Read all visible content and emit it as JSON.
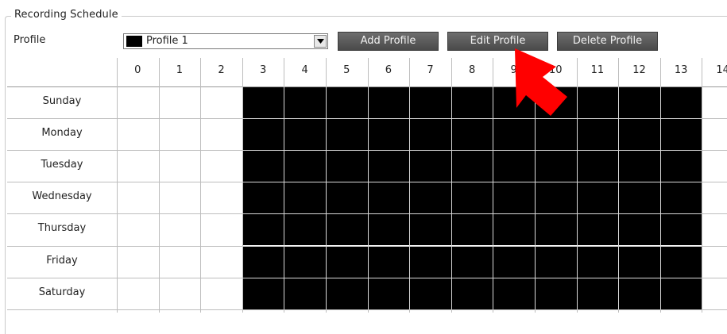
{
  "section": {
    "title": "Recording Schedule"
  },
  "profile": {
    "label": "Profile",
    "selected": "Profile 1",
    "selected_color": "#000000"
  },
  "buttons": {
    "add": "Add Profile",
    "edit": "Edit Profile",
    "delete": "Delete Profile"
  },
  "hours": [
    "0",
    "1",
    "2",
    "3",
    "4",
    "5",
    "6",
    "7",
    "8",
    "9",
    "10",
    "11",
    "12",
    "13",
    "14"
  ],
  "days": [
    "Sunday",
    "Monday",
    "Tuesday",
    "Wednesday",
    "Thursday",
    "Friday",
    "Saturday"
  ],
  "schedule": {
    "active_hours": [
      3,
      4,
      5,
      6,
      7,
      8,
      9,
      10,
      11,
      12,
      13
    ],
    "active_color": "#000000"
  },
  "annotation": {
    "icon": "red-pointer-arrow-icon",
    "color": "#ff0000"
  }
}
